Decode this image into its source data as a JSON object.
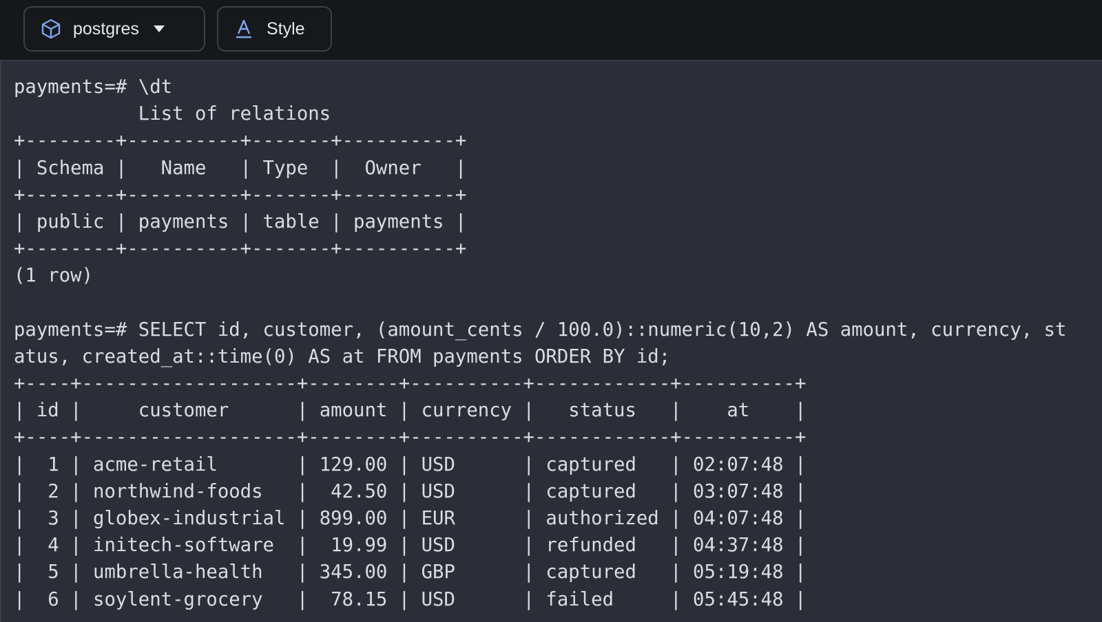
{
  "toolbar": {
    "database_label": "postgres",
    "database_icon": "cube-icon",
    "dropdown_icon": "caret-down-icon",
    "style_label": "Style",
    "style_icon": "font-a-icon"
  },
  "colors": {
    "toolbar_bg": "#15171b",
    "terminal_bg": "#2b2e37",
    "terminal_text": "#d9dce3",
    "button_border": "#3d4047"
  },
  "terminal": {
    "lines": [
      "payments=# \\dt",
      "           List of relations",
      "+--------+----------+-------+----------+",
      "| Schema |   Name   | Type  |  Owner   |",
      "+--------+----------+-------+----------+",
      "| public | payments | table | payments |",
      "+--------+----------+-------+----------+",
      "(1 row)",
      "",
      "payments=# SELECT id, customer, (amount_cents / 100.0)::numeric(10,2) AS amount, currency, st",
      "atus, created_at::time(0) AS at FROM payments ORDER BY id;",
      "+----+-------------------+--------+----------+------------+----------+",
      "| id |     customer      | amount | currency |   status   |    at    |",
      "+----+-------------------+--------+----------+------------+----------+",
      "|  1 | acme-retail       | 129.00 | USD      | captured   | 02:07:48 |",
      "|  2 | northwind-foods   |  42.50 | USD      | captured   | 03:07:48 |",
      "|  3 | globex-industrial | 899.00 | EUR      | authorized | 04:07:48 |",
      "|  4 | initech-software  |  19.99 | USD      | refunded   | 04:37:48 |",
      "|  5 | umbrella-health   | 345.00 | GBP      | captured   | 05:19:48 |",
      "|  6 | soylent-grocery   |  78.15 | USD      | failed     | 05:45:48 |"
    ]
  }
}
